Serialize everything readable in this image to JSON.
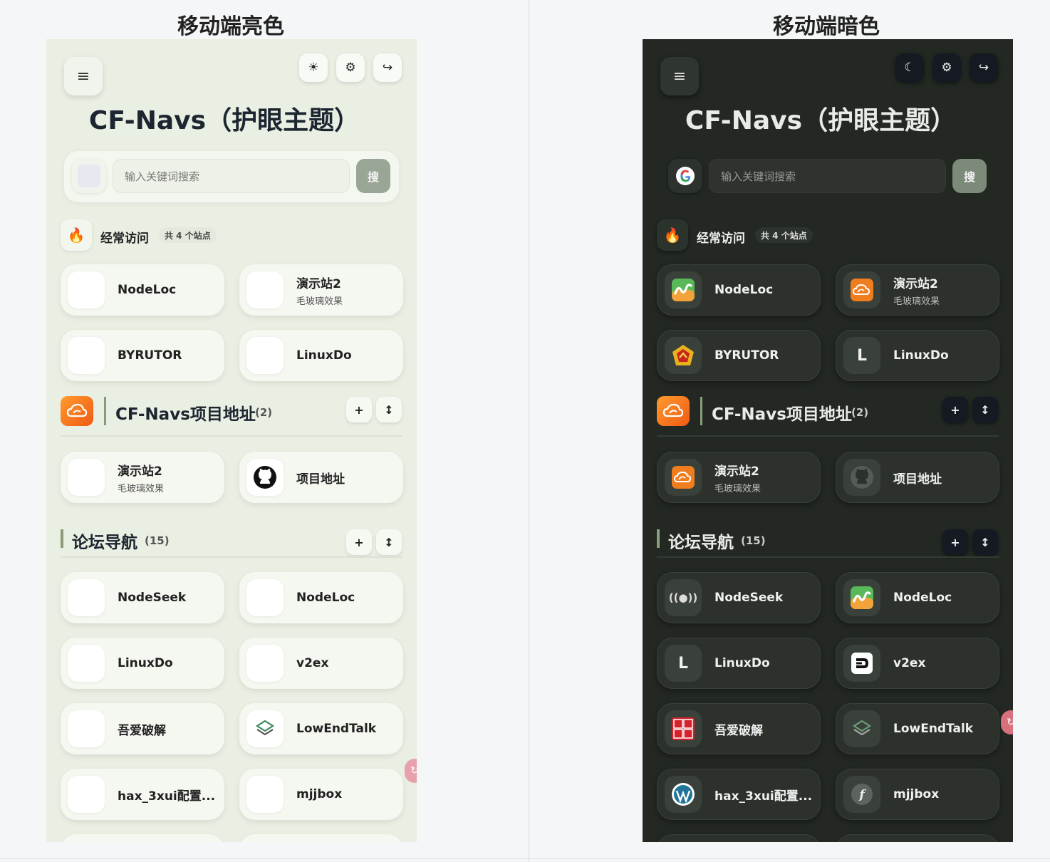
{
  "headers": {
    "light": "移动端亮色",
    "dark": "移动端暗色"
  },
  "app": {
    "title": "CF-Navs（护眼主题）",
    "search_placeholder": "输入关键词搜索",
    "search_button": "搜"
  },
  "frequent": {
    "title": "经常访问",
    "badge": "共 4 个站点",
    "items": [
      {
        "name": "NodeLoc",
        "sub": "",
        "icon": "nodeloc-icon"
      },
      {
        "name": "演示站2",
        "sub": "毛玻璃效果",
        "icon": "cloud-logo-icon"
      },
      {
        "name": "BYRUTOR",
        "sub": "",
        "icon": "byrutor-icon"
      },
      {
        "name": "LinuxDo",
        "sub": "",
        "icon": "letter-l-icon"
      }
    ]
  },
  "section_project": {
    "title": "CF-Navs项目地址",
    "count": "(2)",
    "items": [
      {
        "name": "演示站2",
        "sub": "毛玻璃效果",
        "icon": "cloud-logo-icon"
      },
      {
        "name": "项目地址",
        "sub": "",
        "icon": "github-icon"
      }
    ]
  },
  "section_forum": {
    "title": "论坛导航",
    "count": "(15)",
    "items": [
      {
        "name": "NodeSeek",
        "sub": "",
        "icon": "nodeseek-icon"
      },
      {
        "name": "NodeLoc",
        "sub": "",
        "icon": "nodeloc-icon"
      },
      {
        "name": "LinuxDo",
        "sub": "",
        "icon": "letter-l-icon"
      },
      {
        "name": "v2ex",
        "sub": "",
        "icon": "v2ex-icon"
      },
      {
        "name": "吾爱破解",
        "sub": "",
        "icon": "52pojie-icon"
      },
      {
        "name": "LowEndTalk",
        "sub": "",
        "icon": "layers-icon"
      },
      {
        "name": "hax_3xui配置...",
        "sub": "",
        "icon": "wordpress-icon"
      },
      {
        "name": "mjjbox",
        "sub": "",
        "icon": "mjjbox-icon"
      }
    ]
  },
  "controls": {
    "add": "+",
    "sort": "↕",
    "menu": "≡"
  }
}
